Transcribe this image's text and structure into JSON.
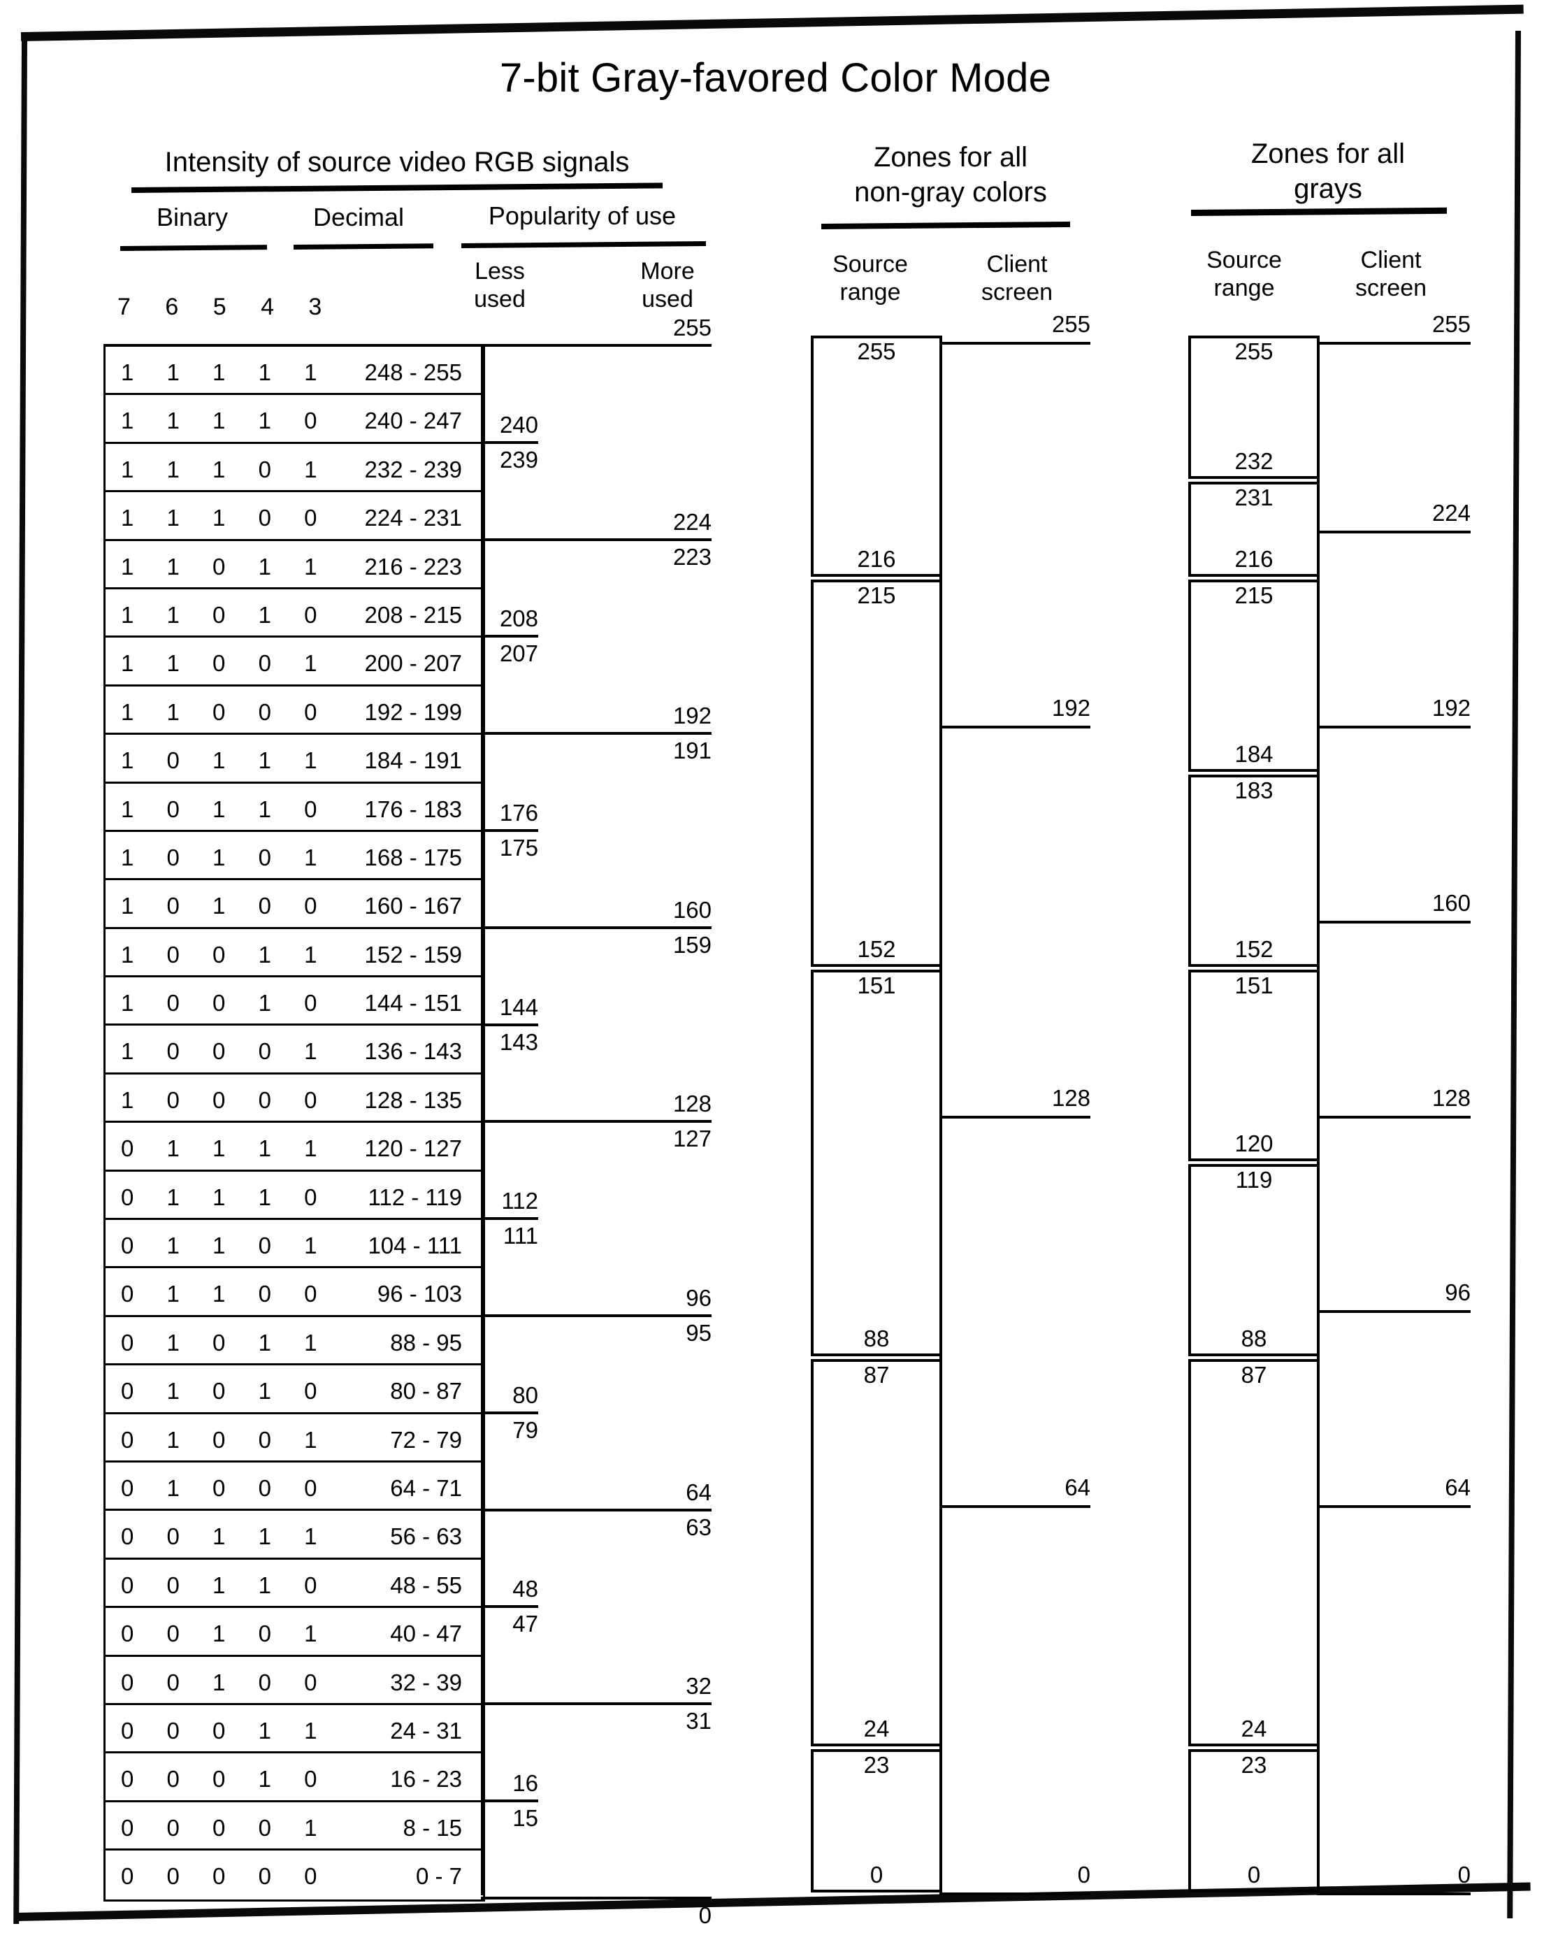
{
  "doc_title": "7-bit Gray-favored Color Mode",
  "sections": {
    "intensity": {
      "title": "Intensity of source video RGB signals",
      "columns": {
        "binary": "Binary",
        "decimal": "Decimal",
        "popularity": "Popularity of use"
      },
      "popularity_subheads": {
        "less": "Less\nused",
        "more": "More\nused"
      },
      "bit_numbers": "7 6 5 4 3"
    },
    "nongray": {
      "title_line1": "Zones for all",
      "title_line2": "non-gray colors",
      "sub_source": "Source\nrange",
      "sub_client": "Client\nscreen"
    },
    "grays": {
      "title_line1": "Zones for all",
      "title_line2": "grays",
      "sub_source": "Source\nrange",
      "sub_client": "Client\nscreen"
    }
  },
  "chart_data": {
    "type": "table",
    "title": "7-bit Gray-favored Color Mode",
    "rows": [
      {
        "binary": "1 1 1 1 1",
        "decimal": "248 - 255"
      },
      {
        "binary": "1 1 1 1 0",
        "decimal": "240 - 247"
      },
      {
        "binary": "1 1 1 0 1",
        "decimal": "232 - 239"
      },
      {
        "binary": "1 1 1 0 0",
        "decimal": "224 - 231"
      },
      {
        "binary": "1 1 0 1 1",
        "decimal": "216 - 223"
      },
      {
        "binary": "1 1 0 1 0",
        "decimal": "208 - 215"
      },
      {
        "binary": "1 1 0 0 1",
        "decimal": "200 - 207"
      },
      {
        "binary": "1 1 0 0 0",
        "decimal": "192 - 199"
      },
      {
        "binary": "1 0 1 1 1",
        "decimal": "184 - 191"
      },
      {
        "binary": "1 0 1 1 0",
        "decimal": "176 - 183"
      },
      {
        "binary": "1 0 1 0 1",
        "decimal": "168 - 175"
      },
      {
        "binary": "1 0 1 0 0",
        "decimal": "160 - 167"
      },
      {
        "binary": "1 0 0 1 1",
        "decimal": "152 - 159"
      },
      {
        "binary": "1 0 0 1 0",
        "decimal": "144 - 151"
      },
      {
        "binary": "1 0 0 0 1",
        "decimal": "136 - 143"
      },
      {
        "binary": "1 0 0 0 0",
        "decimal": "128 - 135"
      },
      {
        "binary": "0 1 1 1 1",
        "decimal": "120 - 127"
      },
      {
        "binary": "0 1 1 1 0",
        "decimal": "112 - 119"
      },
      {
        "binary": "0 1 1 0 1",
        "decimal": "104 - 111"
      },
      {
        "binary": "0 1 1 0 0",
        "decimal": "96 - 103"
      },
      {
        "binary": "0 1 0 1 1",
        "decimal": "88 - 95"
      },
      {
        "binary": "0 1 0 1 0",
        "decimal": "80 - 87"
      },
      {
        "binary": "0 1 0 0 1",
        "decimal": "72 - 79"
      },
      {
        "binary": "0 1 0 0 0",
        "decimal": "64 - 71"
      },
      {
        "binary": "0 0 1 1 1",
        "decimal": "56 - 63"
      },
      {
        "binary": "0 0 1 1 0",
        "decimal": "48 - 55"
      },
      {
        "binary": "0 0 1 0 1",
        "decimal": "40 - 47"
      },
      {
        "binary": "0 0 1 0 0",
        "decimal": "32 - 39"
      },
      {
        "binary": "0 0 0 1 1",
        "decimal": "24 - 31"
      },
      {
        "binary": "0 0 0 1 0",
        "decimal": "16 - 23"
      },
      {
        "binary": "0 0 0 0 1",
        "decimal": "8 - 15"
      },
      {
        "binary": "0 0 0 0 0",
        "decimal": "0 - 7"
      }
    ],
    "popularity_boundaries": [
      {
        "above": "255",
        "below": "",
        "length": "more",
        "row_index": 0,
        "edge": "top"
      },
      {
        "above": "240",
        "below": "239",
        "length": "less",
        "row_index": 2,
        "edge": "top"
      },
      {
        "above": "224",
        "below": "223",
        "length": "more",
        "row_index": 4,
        "edge": "top"
      },
      {
        "above": "208",
        "below": "207",
        "length": "less",
        "row_index": 6,
        "edge": "top"
      },
      {
        "above": "192",
        "below": "191",
        "length": "more",
        "row_index": 8,
        "edge": "top"
      },
      {
        "above": "176",
        "below": "175",
        "length": "less",
        "row_index": 10,
        "edge": "top"
      },
      {
        "above": "160",
        "below": "159",
        "length": "more",
        "row_index": 12,
        "edge": "top"
      },
      {
        "above": "144",
        "below": "143",
        "length": "less",
        "row_index": 14,
        "edge": "top"
      },
      {
        "above": "128",
        "below": "127",
        "length": "more",
        "row_index": 16,
        "edge": "top"
      },
      {
        "above": "112",
        "below": "111",
        "length": "less",
        "row_index": 18,
        "edge": "top"
      },
      {
        "above": "96",
        "below": "95",
        "length": "more",
        "row_index": 20,
        "edge": "top"
      },
      {
        "above": "80",
        "below": "79",
        "length": "less",
        "row_index": 22,
        "edge": "top"
      },
      {
        "above": "64",
        "below": "63",
        "length": "more",
        "row_index": 24,
        "edge": "top"
      },
      {
        "above": "48",
        "below": "47",
        "length": "less",
        "row_index": 26,
        "edge": "top"
      },
      {
        "above": "32",
        "below": "31",
        "length": "more",
        "row_index": 28,
        "edge": "top"
      },
      {
        "above": "16",
        "below": "15",
        "length": "less",
        "row_index": 30,
        "edge": "top"
      },
      {
        "above": "",
        "below": "0",
        "length": "more",
        "row_index": 32,
        "edge": "bottom"
      }
    ],
    "nongray_source_segments": [
      {
        "top": "255",
        "bottom": "216"
      },
      {
        "top": "215",
        "bottom": "152"
      },
      {
        "top": "151",
        "bottom": "88"
      },
      {
        "top": "87",
        "bottom": "24"
      },
      {
        "top": "23",
        "bottom": "0"
      }
    ],
    "nongray_client_levels": [
      "255",
      "192",
      "128",
      "64",
      "0"
    ],
    "grays_source_segments": [
      {
        "top": "255",
        "bottom": "232"
      },
      {
        "top": "231",
        "bottom": "216"
      },
      {
        "top": "215",
        "bottom": "184"
      },
      {
        "top": "183",
        "bottom": "152"
      },
      {
        "top": "151",
        "bottom": "120"
      },
      {
        "top": "119",
        "bottom": "88"
      },
      {
        "top": "87",
        "bottom": "24"
      },
      {
        "top": "23",
        "bottom": "0"
      }
    ],
    "grays_client_levels": [
      "255",
      "224",
      "192",
      "160",
      "128",
      "96",
      "64",
      "0"
    ]
  }
}
